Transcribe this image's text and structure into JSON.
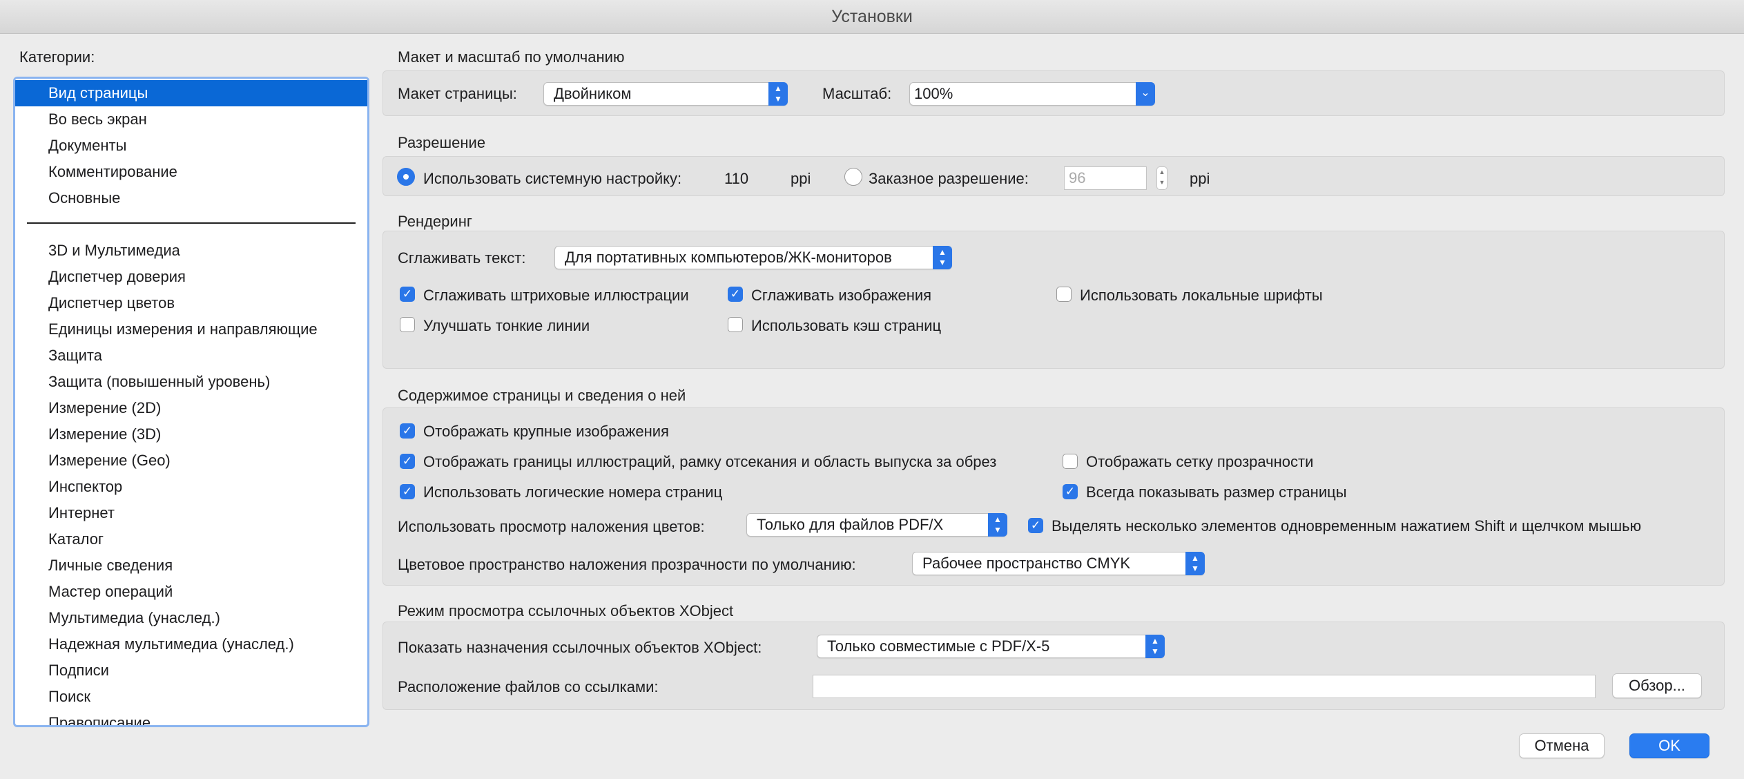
{
  "window": {
    "title": "Установки"
  },
  "sidebar": {
    "header": "Категории:",
    "items_top": [
      "Вид страницы",
      "Во весь экран",
      "Документы",
      "Комментирование",
      "Основные"
    ],
    "items": [
      "3D и Мультимедиа",
      "Диспетчер доверия",
      "Диспетчер цветов",
      "Единицы измерения и направляющие",
      "Защита",
      "Защита (повышенный уровень)",
      "Измерение (2D)",
      "Измерение (3D)",
      "Измерение (Geo)",
      "Инспектор",
      "Интернет",
      "Каталог",
      "Личные сведения",
      "Мастер операций",
      "Мультимедиа (унаслед.)",
      "Надежная мультимедиа (унаслед.)",
      "Подписи",
      "Поиск",
      "Правописание"
    ],
    "selected": "Вид страницы"
  },
  "layout_section": {
    "title": "Макет и масштаб по умолчанию",
    "page_layout_label": "Макет страницы:",
    "page_layout_value": "Двойником",
    "zoom_label": "Масштаб:",
    "zoom_value": "100%"
  },
  "resolution_section": {
    "title": "Разрешение",
    "system_label": "Использовать системную настройку:",
    "system_value": "110",
    "system_unit": "ppi",
    "custom_label": "Заказное разрешение:",
    "custom_value": "96",
    "custom_unit": "ppi"
  },
  "rendering_section": {
    "title": "Рендеринг",
    "smooth_text_label": "Сглаживать текст:",
    "smooth_text_value": "Для портативных компьютеров/ЖК-мониторов",
    "smooth_line_art": "Сглаживать штриховые иллюстрации",
    "smooth_images": "Сглаживать изображения",
    "local_fonts": "Использовать локальные шрифты",
    "enhance_thin_lines": "Улучшать тонкие линии",
    "page_cache": "Использовать кэш страниц"
  },
  "content_section": {
    "title": "Содержимое страницы и сведения о ней",
    "large_images": "Отображать крупные изображения",
    "art_trim_bleed": "Отображать границы иллюстраций, рамку отсекания и область выпуска за обрез",
    "transparency_grid": "Отображать сетку прозрачности",
    "logical_page_numbers": "Использовать логические номера страниц",
    "always_page_size": "Всегда показывать размер страницы",
    "overprint_label": "Использовать просмотр наложения цветов:",
    "overprint_value": "Только для файлов PDF/X",
    "multi_select": "Выделять несколько элементов одновременным нажатием Shift и щелчком мышью",
    "blend_space_label": "Цветовое пространство наложения прозрачности по умолчанию:",
    "blend_space_value": "Рабочее пространство CMYK"
  },
  "xobject_section": {
    "title": "Режим просмотра ссылочных объектов XObject",
    "show_targets_label": "Показать назначения ссылочных объектов XObject:",
    "show_targets_value": "Только совместимые с PDF/X-5",
    "location_label": "Расположение файлов со ссылками:",
    "location_value": "",
    "browse_label": "Обзор..."
  },
  "footer": {
    "cancel_label": "Отмена",
    "ok_label": "OK"
  },
  "colors": {
    "accent": "#2a76e8",
    "selection": "#0a68d6"
  }
}
